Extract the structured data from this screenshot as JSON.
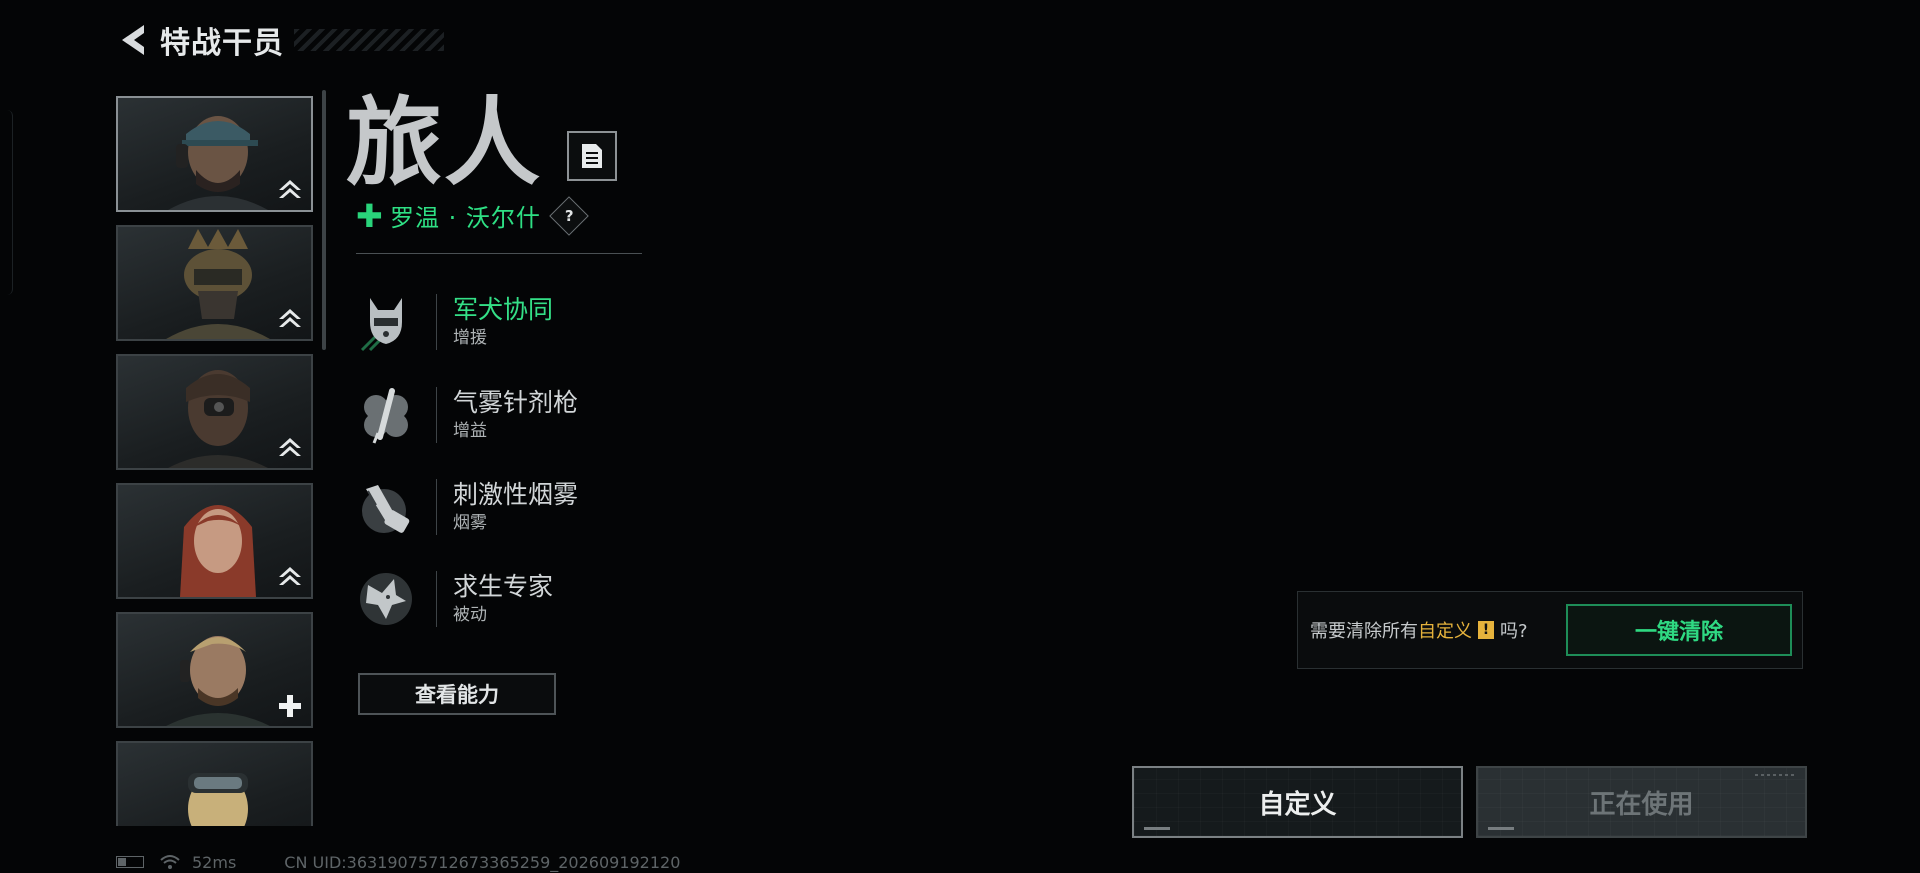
{
  "header": {
    "title": "特战干员"
  },
  "operators": [
    {
      "name": "operator-1",
      "badge": "rank-up"
    },
    {
      "name": "operator-2",
      "badge": "rank-up"
    },
    {
      "name": "operator-3",
      "badge": "rank-up"
    },
    {
      "name": "operator-4",
      "badge": "rank-up"
    },
    {
      "name": "operator-5",
      "badge": "plus"
    },
    {
      "name": "operator-6",
      "badge": "none"
    }
  ],
  "operator": {
    "name": "旅人",
    "subname": "罗温 · 沃尔什",
    "help": "?"
  },
  "abilities": [
    {
      "name": "军犬协同",
      "type": "增援",
      "icon": "dog-icon",
      "active": true
    },
    {
      "name": "气雾针剂枪",
      "type": "增益",
      "icon": "syringe-gun-icon",
      "active": false
    },
    {
      "name": "刺激性烟雾",
      "type": "烟雾",
      "icon": "smoke-grenade-icon",
      "active": false
    },
    {
      "name": "求生专家",
      "type": "被动",
      "icon": "wolf-emblem-icon",
      "active": false
    }
  ],
  "view_abilities_label": "查看能力",
  "clear_panel": {
    "prompt_prefix": "需要清除所有",
    "prompt_highlight": "自定义",
    "warn_mark": "!",
    "prompt_suffix": "吗?",
    "button_label": "一键清除"
  },
  "buttons": {
    "customize": "自定义",
    "in_use": "正在使用"
  },
  "status": {
    "ping": "52ms",
    "uid": "CN UID:36319075712673365259_202609192120"
  },
  "colors": {
    "accent_green": "#2ee084",
    "highlight_yellow": "#e6b33c",
    "background": "#040506"
  }
}
